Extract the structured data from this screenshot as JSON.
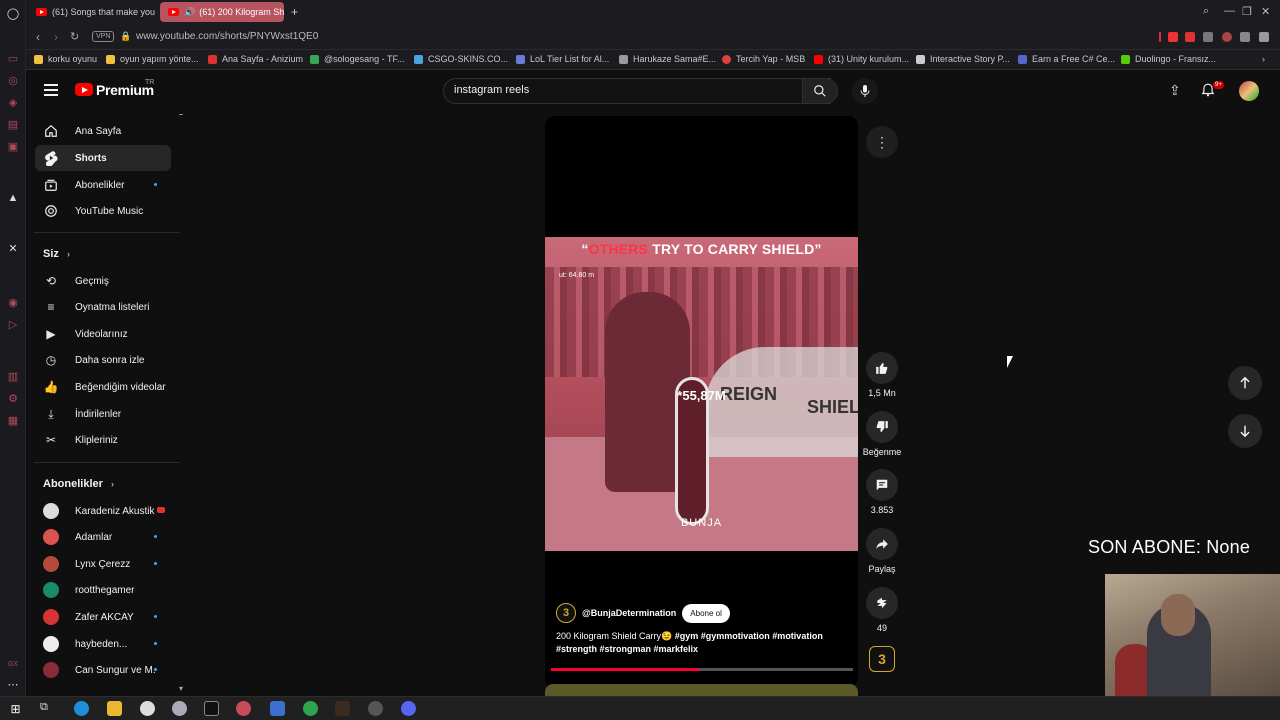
{
  "browser": {
    "tabs": [
      {
        "label": "(61) Songs that make you",
        "active": false
      },
      {
        "label": "(61) 200 Kilogram Shi",
        "active": true
      }
    ],
    "new_tab": "+",
    "url": "www.youtube.com/shorts/PNYWxst1QE0",
    "vpn": "VPN",
    "bookmarks": [
      {
        "label": "korku oyunu",
        "color": "#f0c040"
      },
      {
        "label": "oyun yapım yönte...",
        "color": "#f0c040"
      },
      {
        "label": "Ana Sayfa - Anizium",
        "color": "#e03030"
      },
      {
        "label": "@sologesang - TF...",
        "color": "#3aa655"
      },
      {
        "label": "CSGO-SKINS.CO...",
        "color": "#4aa3df"
      },
      {
        "label": "LoL Tier List for Al...",
        "color": "#6a7bd6"
      },
      {
        "label": "Harukaze Sama#E...",
        "color": "#9a9a9a"
      },
      {
        "label": "Tercih Yap - MSB",
        "color": "#e04040"
      },
      {
        "label": "(31) Unity kurulum...",
        "color": "#ff0000"
      },
      {
        "label": "Interactive Story P...",
        "color": "#cccccc"
      },
      {
        "label": "Earn a Free C# Ce...",
        "color": "#5566cc"
      },
      {
        "label": "Duolingo - Fransız...",
        "color": "#58cc02"
      }
    ]
  },
  "youtube": {
    "logo": "Premium",
    "region": "TR",
    "search_value": "instagram reels",
    "search_placeholder": "Ara",
    "notif_badge": "9+",
    "nav": [
      {
        "label": "Ana Sayfa",
        "icon": "home-icon"
      },
      {
        "label": "Shorts",
        "icon": "shorts-icon",
        "active": true
      },
      {
        "label": "Abonelikler",
        "icon": "subscriptions-icon",
        "dot": true
      },
      {
        "label": "YouTube Music",
        "icon": "music-icon"
      }
    ],
    "you_title": "Siz",
    "you_items": [
      {
        "label": "Geçmiş",
        "icon": "history-icon"
      },
      {
        "label": "Oynatma listeleri",
        "icon": "playlist-icon"
      },
      {
        "label": "Videolarınız",
        "icon": "your-videos-icon"
      },
      {
        "label": "Daha sonra izle",
        "icon": "watch-later-icon"
      },
      {
        "label": "Beğendiğim videolar",
        "icon": "liked-icon"
      },
      {
        "label": "İndirilenler",
        "icon": "download-icon"
      },
      {
        "label": "Klipleriniz",
        "icon": "clips-icon"
      }
    ],
    "subs_title": "Abonelikler",
    "subscriptions": [
      {
        "label": "Karadeniz Akustik",
        "color": "#dddddd",
        "live": true
      },
      {
        "label": "Adamlar",
        "color": "#d9534f",
        "dot": true
      },
      {
        "label": "Lynx Çerezz",
        "color": "#b54a3a",
        "dot": true
      },
      {
        "label": "rootthegamer",
        "color": "#1a8a6a",
        "dot": false
      },
      {
        "label": "Zafer AKCAY",
        "color": "#d63333",
        "dot": true
      },
      {
        "label": "haybeden...",
        "color": "#eeeeee",
        "dot": true
      },
      {
        "label": "Can Sungur ve M...",
        "color": "#8a2b3a",
        "dot": true
      }
    ]
  },
  "short": {
    "caption_quote_open": "“",
    "caption_red": "OTHERS",
    "caption_rest": " TRY TO CARRY SHIELD”",
    "overlay_number": "*55,87M",
    "overlay_sig": "BUNJA",
    "overlay_reign": "REIGN",
    "overlay_shield": "SHIELD",
    "overlay_side": "ut: 64.80 m",
    "channel": "@BunjaDetermination",
    "channel_initial": "3",
    "subscribe": "Abone ol",
    "desc_title": "200 Kilogram Shield Carry😉",
    "desc_tags": "#gym #gymmotivation #motivation #strength #strongman #markfelix",
    "progress": 0.49,
    "likes": "1,5 Mn",
    "dislike": "Beğenme",
    "comments": "3.853",
    "share": "Paylaş",
    "remix": "49"
  },
  "overlay": {
    "son_abone": "SON ABONE: None"
  }
}
